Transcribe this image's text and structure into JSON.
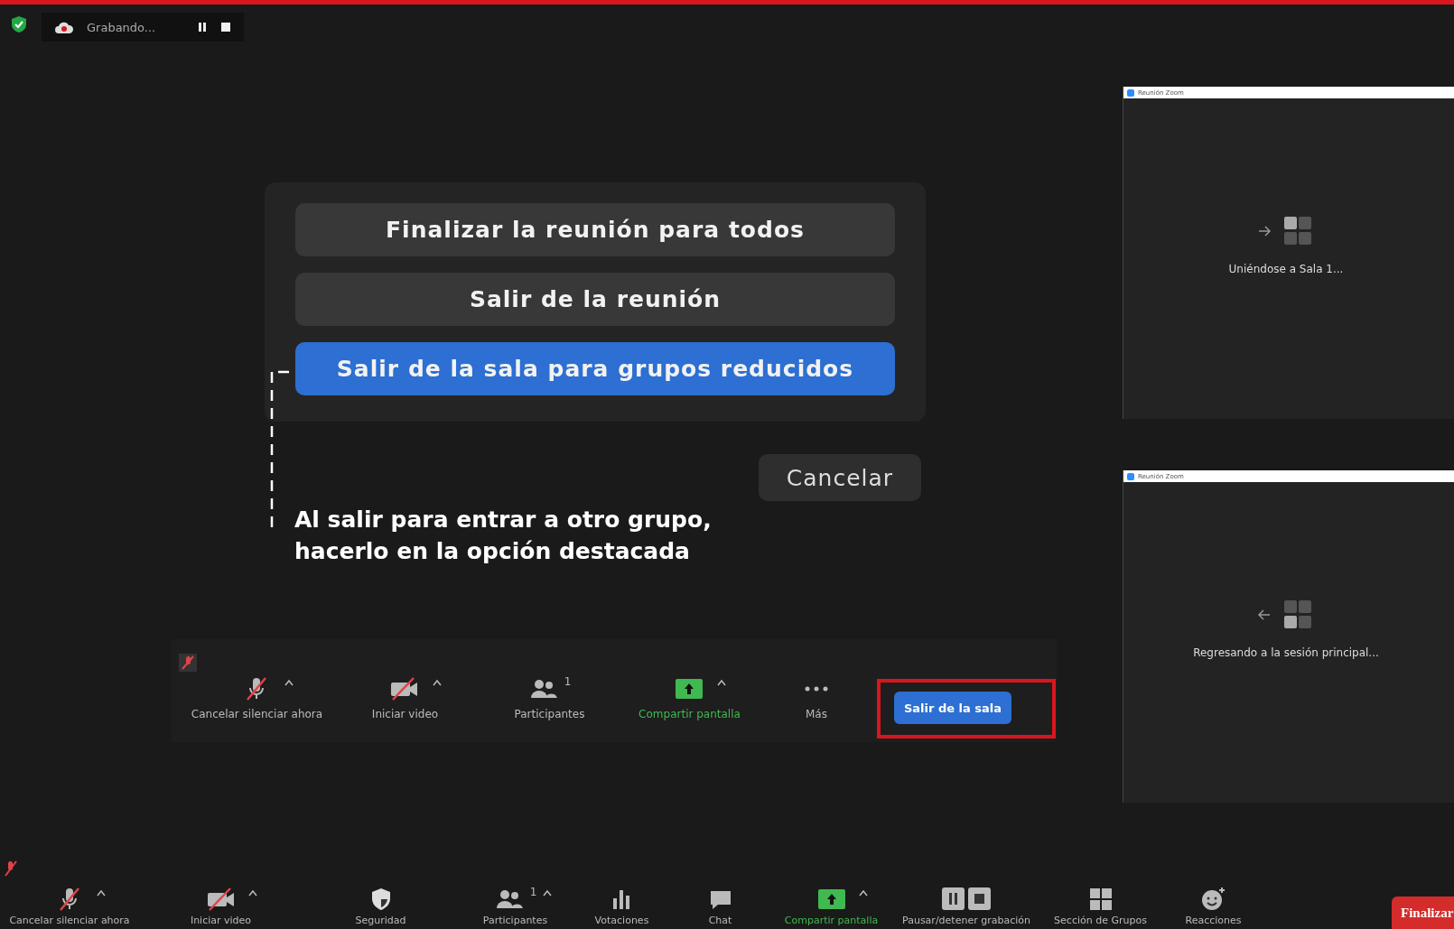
{
  "recording": {
    "status": "Grabando..."
  },
  "dialog": {
    "options": [
      {
        "label": "Finalizar la reunión para todos",
        "selected": false
      },
      {
        "label": "Salir de la reunión",
        "selected": false
      },
      {
        "label": "Salir de la sala para grupos reducidos",
        "selected": true
      }
    ],
    "cancel": "Cancelar"
  },
  "annotation": {
    "lines": [
      "Al salir para entrar a otro grupo,",
      "hacerlo en la opción destacada"
    ]
  },
  "room_toolbar": {
    "items": [
      {
        "kind": "mic-off",
        "label": "Cancelar silenciar ahora",
        "menu": true
      },
      {
        "kind": "video-off",
        "label": "Iniciar video",
        "menu": true
      },
      {
        "kind": "participants",
        "label": "Participantes",
        "count": "1",
        "menu": false
      },
      {
        "kind": "share",
        "label": "Compartir pantalla",
        "menu": true,
        "highlight": true
      },
      {
        "kind": "more",
        "label": "Más",
        "menu": false
      }
    ],
    "leave": "Salir de la sala"
  },
  "breakout_windows": [
    {
      "title": "Reunión Zoom",
      "kind": "joining",
      "message": "Uniéndose a Sala 1..."
    },
    {
      "title": "Reunión Zoom",
      "kind": "returning",
      "message": "Regresando a la sesión principal..."
    }
  ],
  "main_toolbar": {
    "items": [
      {
        "kind": "mic-off",
        "label": "Cancelar silenciar ahora",
        "menu": true
      },
      {
        "kind": "video-off",
        "label": "Iniciar video",
        "menu": true
      },
      {
        "kind": "security",
        "label": "Seguridad",
        "menu": false
      },
      {
        "kind": "participants",
        "label": "Participantes",
        "count": "1",
        "menu": true
      },
      {
        "kind": "polls",
        "label": "Votaciones",
        "menu": false
      },
      {
        "kind": "chat",
        "label": "Chat",
        "menu": false
      },
      {
        "kind": "share",
        "label": "Compartir pantalla",
        "menu": true,
        "highlight": true
      },
      {
        "kind": "pause-stop",
        "label": "Pausar/detener grabación",
        "menu": false
      },
      {
        "kind": "breakout",
        "label": "Sección de Grupos",
        "menu": false
      },
      {
        "kind": "reactions",
        "label": "Reacciones",
        "menu": false
      }
    ],
    "end": "Finalizar"
  }
}
